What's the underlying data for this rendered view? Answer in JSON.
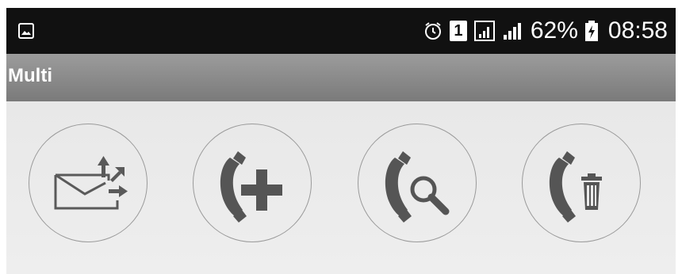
{
  "status_bar": {
    "battery_percent": "62%",
    "time": "08:58",
    "sim_label": "1",
    "icons": [
      "gallery-icon",
      "alarm-icon",
      "sim-icon",
      "signal-box-icon",
      "signal-icon",
      "battery-charging-icon"
    ]
  },
  "action_bar": {
    "title": "Multi"
  },
  "actions": [
    {
      "name": "send-message",
      "icon": "envelope-send-icon"
    },
    {
      "name": "add-call",
      "icon": "phone-add-icon"
    },
    {
      "name": "search-call",
      "icon": "phone-search-icon"
    },
    {
      "name": "delete-call",
      "icon": "phone-delete-icon"
    }
  ],
  "colors": {
    "status_bar": "#111111",
    "action_bar": "#8a8a8a",
    "background": "#ebebeb",
    "icon": "#555555"
  }
}
